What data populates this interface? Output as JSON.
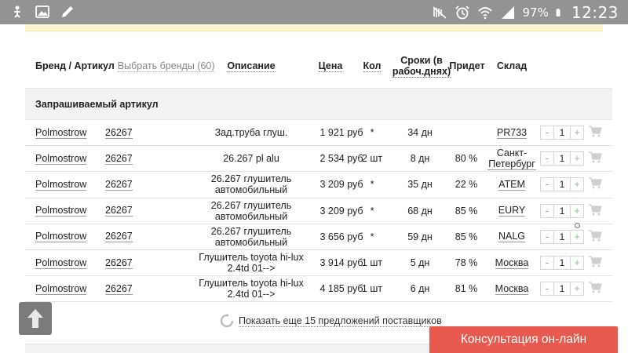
{
  "statusbar": {
    "battery": "97%",
    "time": "12:23",
    "icons": [
      "usb-debug-icon",
      "image-icon",
      "pen-icon",
      "mute-icon",
      "alarm-icon",
      "wifi-icon",
      "signal-icon",
      "battery-icon"
    ]
  },
  "table": {
    "headers": {
      "brand": "Бренд / Артикул",
      "brands_link": "Выбрать бренды (60)",
      "description": "Описание",
      "price": "Цена",
      "qty": "Кол",
      "term": "Сроки (в рабоч.днях)",
      "arrive": "Придет",
      "store": "Склад"
    },
    "section_title": "Запрашиваемый артикул",
    "rows": [
      {
        "brand": "Polmostrow",
        "article": "26267",
        "description": "Зад.труба глуш.",
        "price": "1 921 руб",
        "qty": "*",
        "term": "34 дн",
        "arrive": "",
        "store": "PR733",
        "amount": "1"
      },
      {
        "brand": "Polmostrow",
        "article": "26267",
        "description": "26.267 pl alu",
        "price": "2 534 руб",
        "qty": "2 шт",
        "term": "8 дн",
        "arrive": "80 %",
        "store": "Санкт-Петербург",
        "amount": "1"
      },
      {
        "brand": "Polmostrow",
        "article": "26267",
        "description": "26.267 глушитель автомобильный",
        "price": "3 209 руб",
        "qty": "*",
        "term": "35 дн",
        "arrive": "22 %",
        "store": "ATEM",
        "amount": "1"
      },
      {
        "brand": "Polmostrow",
        "article": "26267",
        "description": "26.267 глушитель автомобильный",
        "price": "3 209 руб",
        "qty": "*",
        "term": "68 дн",
        "arrive": "85 %",
        "store": "EURY",
        "amount": "1"
      },
      {
        "brand": "Polmostrow",
        "article": "26267",
        "description": "26.267 глушитель автомобильный",
        "price": "3 656 руб",
        "qty": "*",
        "term": "59 дн",
        "arrive": "85 %",
        "store": "NALG",
        "amount": "1"
      },
      {
        "brand": "Polmostrow",
        "article": "26267",
        "description": "Глушитель toyota hi-lux 2.4td 01-->",
        "price": "3 914 руб",
        "qty": "1 шт",
        "term": "5 дн",
        "arrive": "78 %",
        "store": "Москва",
        "amount": "1"
      },
      {
        "brand": "Polmostrow",
        "article": "26267",
        "description": "Глушитель toyota hi-lux 2.4td 01-->",
        "price": "4 185 руб",
        "qty": "1 шт",
        "term": "6 дн",
        "arrive": "81 %",
        "store": "Москва",
        "amount": "1"
      }
    ],
    "stepper": {
      "minus": "-",
      "plus": "+"
    }
  },
  "more_offers": "Показать еще 15 предложений поставщиков",
  "consult_button": "Консультация он-лайн",
  "colors": {
    "accent": "#e85a4f",
    "statusbar": "#939393",
    "section_bg": "#f2f2f2"
  }
}
